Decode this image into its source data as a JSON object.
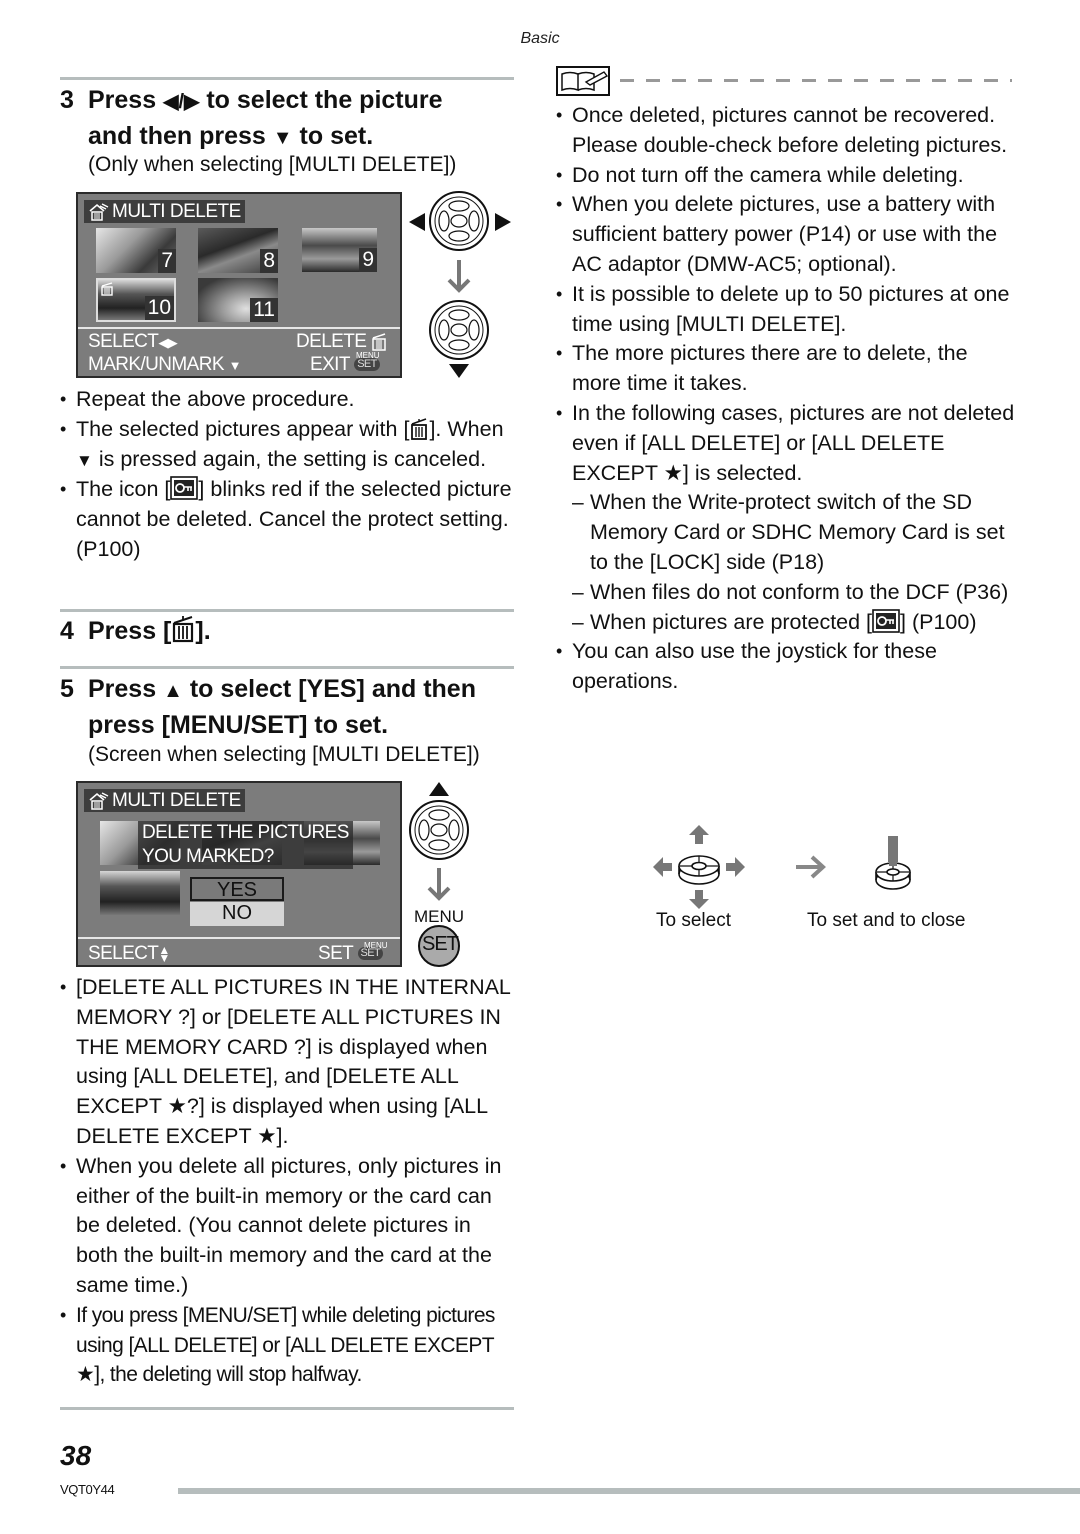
{
  "header": {
    "section": "Basic"
  },
  "left": {
    "step3": {
      "number": "3",
      "line1_pre": "Press",
      "line1_post": "to select the picture",
      "line2_pre": "and then press",
      "line2_post": "to set.",
      "note": "(Only when selecting [MULTI DELETE])"
    },
    "screen1": {
      "title": "MULTI DELETE",
      "thumbnails": [
        {
          "number": "7",
          "marked": false
        },
        {
          "number": "8",
          "marked": false
        },
        {
          "number": "9",
          "marked": false
        },
        {
          "number": "10",
          "marked": true
        },
        {
          "number": "11",
          "marked": false
        }
      ],
      "footer": {
        "select": "SELECT",
        "delete": "DELETE",
        "mark": "MARK/UNMARK",
        "exit": "EXIT",
        "menu_small": "MENU",
        "set_pill": "SET"
      }
    },
    "step3_bullets": [
      {
        "text": "Repeat the above procedure."
      },
      {
        "pre": "The selected pictures appear with [",
        "post": "]. When",
        "post2": "is pressed again, the setting is canceled."
      },
      {
        "pre": "The icon [",
        "post": "] blinks red if the selected picture cannot be deleted. Cancel the protect setting. (P100)"
      }
    ],
    "step4": {
      "number": "4",
      "pre": "Press [",
      "post": "]."
    },
    "step5": {
      "number": "5",
      "line1_pre": "Press",
      "line1_post": "to select [YES] and then",
      "line2": "press [MENU/SET] to set.",
      "note": "(Screen when selecting [MULTI DELETE])"
    },
    "screen2": {
      "title": "MULTI DELETE",
      "question_line1": "DELETE THE PICTURES",
      "question_line2": "YOU MARKED?",
      "options": [
        "YES",
        "NO"
      ],
      "selected_option": "YES",
      "footer": {
        "select": "SELECT",
        "set": "SET",
        "menu_small": "MENU",
        "set_pill": "SET"
      },
      "side_menu_label": "MENU",
      "side_set_label": "SET"
    },
    "step5_bullets": [
      {
        "text": "[DELETE ALL PICTURES IN THE INTERNAL MEMORY ?] or [DELETE ALL PICTURES IN THE MEMORY CARD ?] is displayed when using [ALL DELETE], and [DELETE ALL EXCEPT ★?] is displayed when using [ALL DELETE EXCEPT ★]."
      },
      {
        "text": "When you delete all pictures, only pictures in either of the built-in memory or the card can be deleted. (You cannot delete pictures in both the built-in memory and the card at the same time.)"
      },
      {
        "text": "If you press [MENU/SET] while deleting pictures using [ALL DELETE] or [ALL DELETE EXCEPT ★], the deleting will stop halfway."
      }
    ]
  },
  "right": {
    "notes_icon": "book-pencil-icon",
    "bullets": [
      {
        "text": "Once deleted, pictures cannot be recovered. Please double-check before deleting pictures."
      },
      {
        "text": "Do not turn off the camera while deleting."
      },
      {
        "text": "When you delete pictures, use a battery with sufficient battery power (P14) or use with the AC adaptor (DMW-AC5; optional)."
      },
      {
        "text": "It is possible to delete up to 50 pictures at one time using [MULTI DELETE]."
      },
      {
        "text": "The more pictures there are to delete, the more time it takes."
      },
      {
        "text": "In the following cases, pictures are not deleted even if [ALL DELETE] or [ALL DELETE EXCEPT ★] is selected."
      }
    ],
    "sub_items": [
      {
        "text": "When the Write-protect switch of the SD Memory Card or SDHC Memory Card is set to the [LOCK] side (P18)"
      },
      {
        "text": "When files do not conform to the DCF (P36)"
      },
      {
        "pre": "When pictures are protected [",
        "post": "] (P100)"
      }
    ],
    "last_bullet": {
      "text": "You can also use the joystick for these operations."
    },
    "joystick": {
      "caption_select": "To select",
      "caption_set": "To set and to close"
    }
  },
  "footer": {
    "page_number": "38",
    "doc_code": "VQT0Y44"
  }
}
